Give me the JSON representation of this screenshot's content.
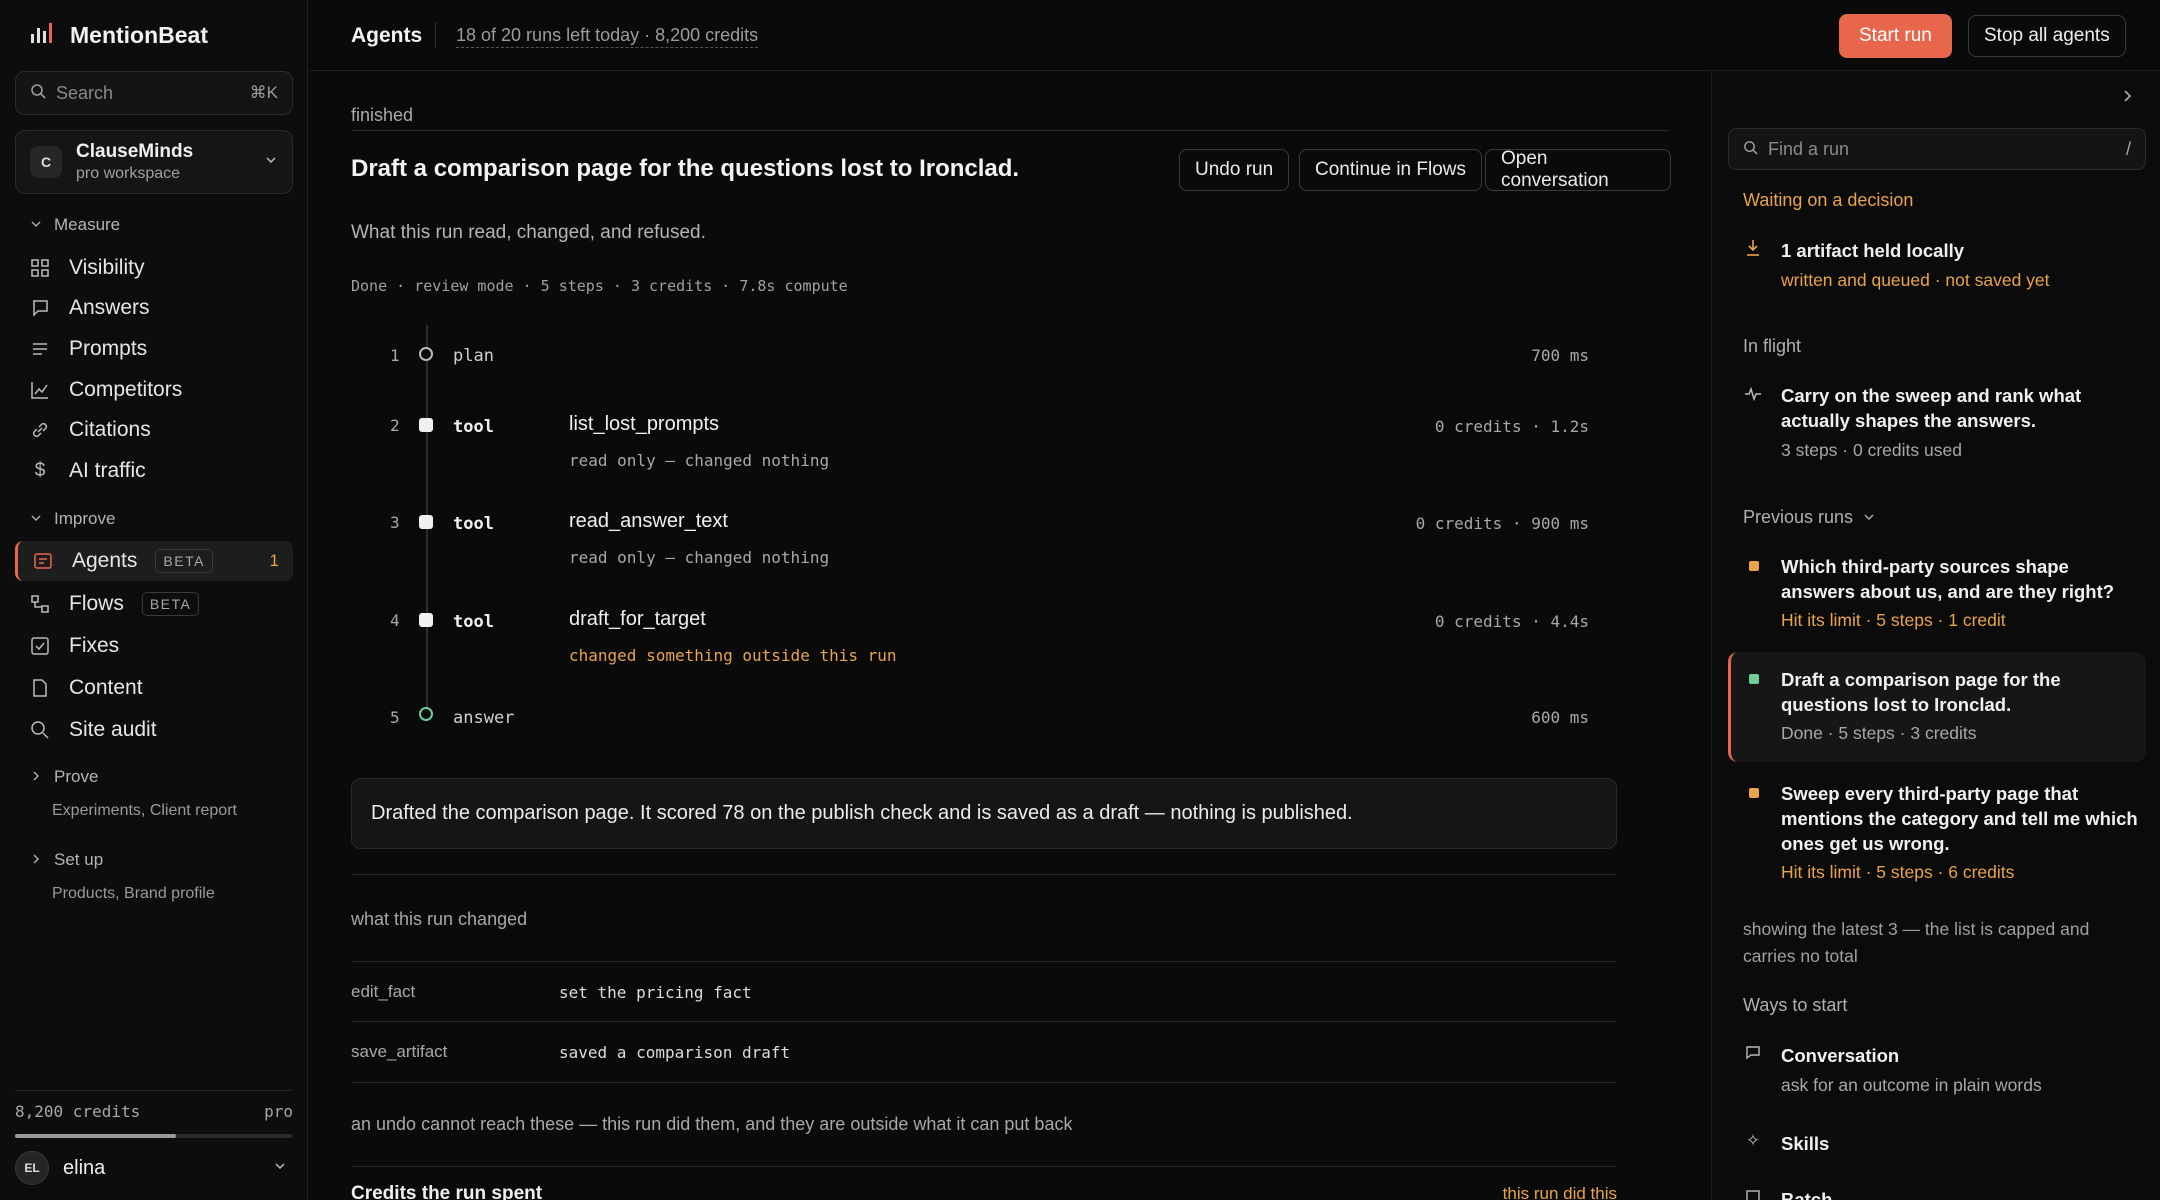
{
  "app": {
    "name": "MentionBeat"
  },
  "sidebar": {
    "search": {
      "placeholder": "Search",
      "shortcut": "⌘K"
    },
    "workspace": {
      "initial": "C",
      "name": "ClauseMinds",
      "plan": "pro workspace"
    },
    "groups": {
      "measure": "Measure",
      "improve": "Improve",
      "prove": "Prove",
      "prove_links": "Experiments, Client report",
      "setup": "Set up",
      "setup_links": "Products, Brand profile"
    },
    "items": {
      "visibility": "Visibility",
      "answers": "Answers",
      "prompts": "Prompts",
      "competitors": "Competitors",
      "citations": "Citations",
      "ai_traffic": "AI traffic",
      "agents": "Agents",
      "agents_badge": "BETA",
      "agents_count": "1",
      "flows": "Flows",
      "flows_badge": "BETA",
      "fixes": "Fixes",
      "content": "Content",
      "site_audit": "Site audit"
    },
    "credits": {
      "label": "8,200 credits",
      "plan": "pro",
      "fill": 0.58
    },
    "user": {
      "initials": "EL",
      "name": "elina"
    }
  },
  "topbar": {
    "title": "Agents",
    "meta": "18 of 20 runs left today · 8,200 credits",
    "start": "Start run",
    "stop": "Stop all agents"
  },
  "run": {
    "status": "finished",
    "title": "Draft a comparison page for the questions lost to Ironclad.",
    "actions": {
      "undo": "Undo run",
      "continue": "Continue in Flows",
      "open": "Open conversation"
    },
    "subtitle": "What this run read, changed, and refused.",
    "stats": "Done · review mode · 5 steps · 3 credits · 7.8s compute",
    "steps": [
      {
        "num": "1",
        "kind": "plan",
        "name": "",
        "note": "",
        "meta": "700 ms"
      },
      {
        "num": "2",
        "kind": "tool",
        "name": "list_lost_prompts",
        "note": "read only — changed nothing",
        "meta": "0 credits · 1.2s"
      },
      {
        "num": "3",
        "kind": "tool",
        "name": "read_answer_text",
        "note": "read only — changed nothing",
        "meta": "0 credits · 900 ms"
      },
      {
        "num": "4",
        "kind": "tool",
        "name": "draft_for_target",
        "note": "changed something outside this run",
        "meta": "0 credits · 4.4s"
      },
      {
        "num": "5",
        "kind": "answer",
        "name": "",
        "note": "",
        "meta": "600 ms"
      }
    ],
    "answer": "Drafted the comparison page. It scored 78 on the publish check and is saved as a draft — nothing is published.",
    "changed_label": "what this run changed",
    "changes": [
      {
        "key": "edit_fact",
        "value": "set the pricing fact"
      },
      {
        "key": "save_artifact",
        "value": "saved a comparison draft"
      }
    ],
    "undo_note": "an undo cannot reach these — this run did them, and they are outside what it can put back",
    "credits_title": "Credits the run spent",
    "credits_side": "this run did this"
  },
  "panel": {
    "search_placeholder": "Find a run",
    "search_shortcut": "/",
    "waiting": {
      "heading": "Waiting on a decision",
      "title": "1 artifact held locally",
      "sub": "written and queued · not saved yet"
    },
    "inflight": {
      "heading": "In flight",
      "title": "Carry on the sweep and rank what actually shapes the answers.",
      "sub": "3 steps · 0 credits used"
    },
    "previous": {
      "heading": "Previous runs",
      "runs": [
        {
          "title": "Which third-party sources shape answers about us, and are they right?",
          "sub": "Hit its limit · 5 steps · 1 credit"
        },
        {
          "title": "Draft a comparison page for the questions lost to Ironclad.",
          "sub": "Done · 5 steps · 3 credits"
        },
        {
          "title": "Sweep every third-party page that mentions the category and tell me which ones get us wrong.",
          "sub": "Hit its limit · 5 steps · 6 credits"
        }
      ],
      "note": "showing the latest 3 — the list is capped and carries no total"
    },
    "ways": {
      "heading": "Ways to start",
      "conversation": "Conversation",
      "conversation_sub": "ask for an outcome in plain words",
      "skills": "Skills",
      "batch": "Batch"
    }
  }
}
